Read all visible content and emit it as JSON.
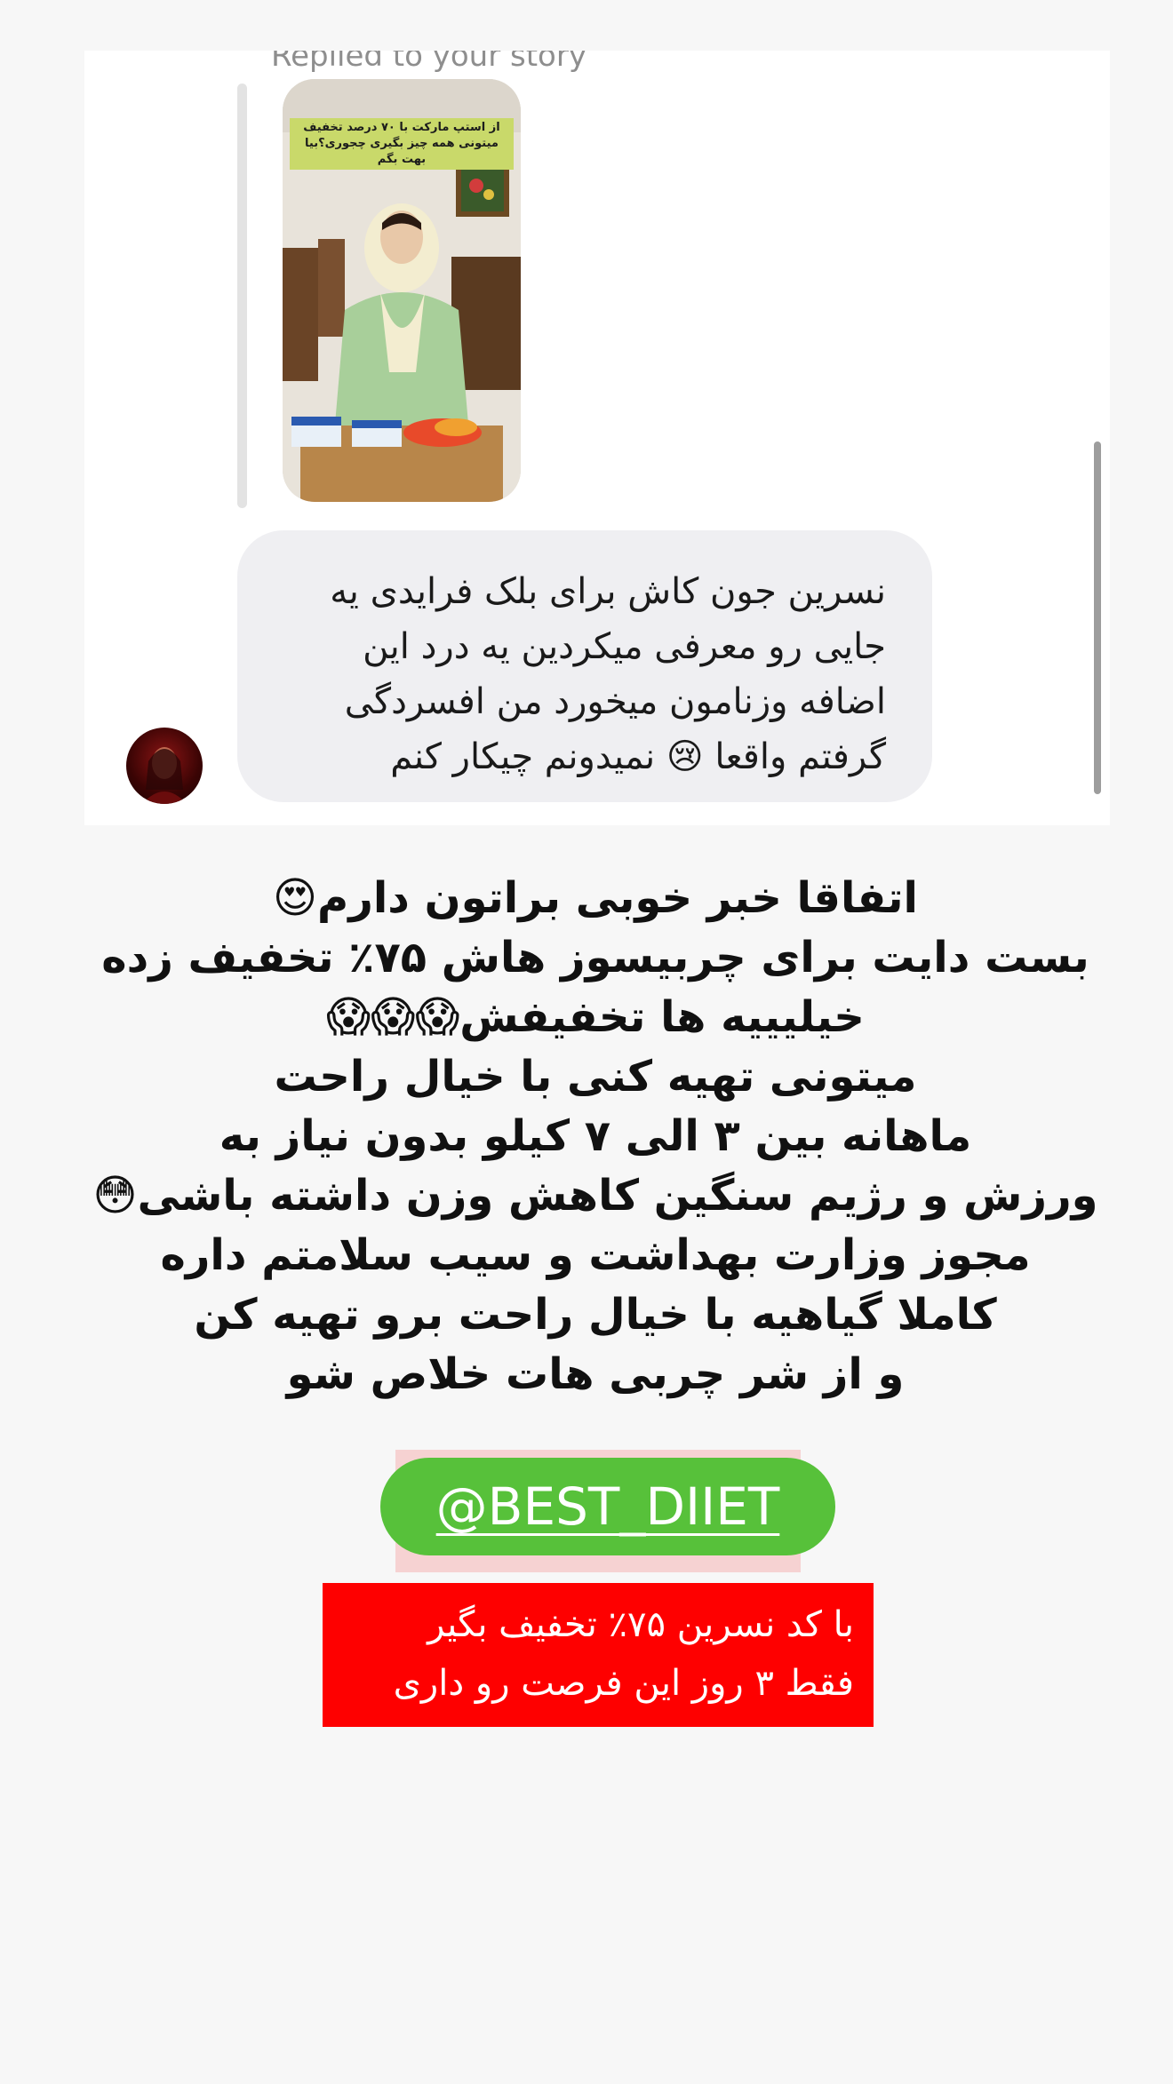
{
  "dm": {
    "replied_label": "Replied to your story",
    "story_overlay_text": "از استپ مارکت با ۷۰ درصد تخفیف میتونی همه چیز بگیری چجوری؟بیا بهت بگم",
    "message_lines": [
      "نسرین جون کاش برای بلک فرایدی یه",
      "جایی رو معرفی میکردین یه درد این",
      "اضافه وزنامون میخورد من افسردگی",
      "گرفتم واقعا 😢 نمیدونم چیکار کنم"
    ]
  },
  "promo": {
    "lines": [
      "اتفاقا خبر خوبی براتون دارم😍",
      "بست دایت برای چربیسوز هاش ۷۵٪ تخفیف زده",
      "خیلیییه ها تخفیفش😱😱😱",
      "میتونی تهیه کنی با خیال راحت",
      "ماهانه بین ۳ الی ۷ کیلو بدون نیاز به",
      "ورزش و رژیم سنگین کاهش وزن داشته باشی😳",
      "مجوز وزارت بهداشت و سیب سلامتم داره",
      "کاملا گیاهیه با خیال راحت برو تهیه کن",
      "و از شر چربی هات خلاص شو"
    ]
  },
  "link": {
    "label": "@BEST_DIIET",
    "color": "#57c13a"
  },
  "discount": {
    "lines": [
      "با کد نسرین ۷۵٪ تخفیف بگیر",
      "فقط ۳ روز این فرصت رو داری"
    ],
    "color": "#fe0000"
  }
}
